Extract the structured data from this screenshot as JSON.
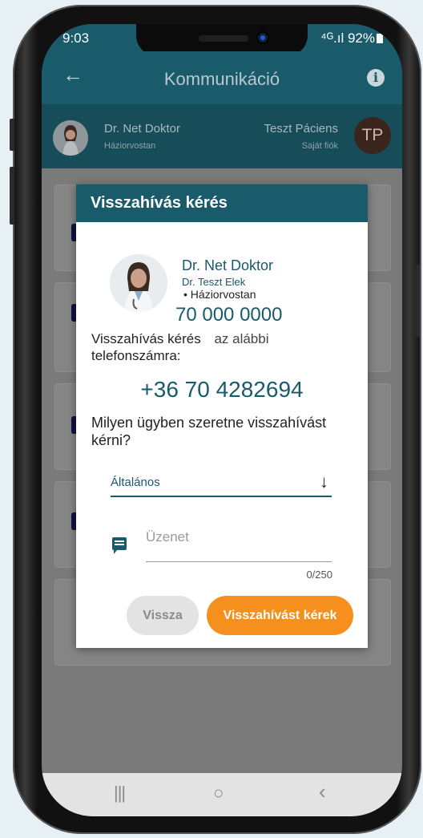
{
  "status": {
    "time": "9:03",
    "icons": "⁴ᴳ.ıl 92%",
    "battery_icon": "battery-icon"
  },
  "appbar": {
    "title": "Kommunikáció",
    "back_icon": "arrow-left-icon",
    "info_icon": "info-icon",
    "info_glyph": "i"
  },
  "userbar": {
    "doctor_name": "Dr. Net Doktor",
    "doctor_role": "Háziorvostan",
    "patient_name": "Teszt Páciens",
    "patient_role": "Saját fiók",
    "patient_initials": "TP"
  },
  "dialog": {
    "title": "Visszahívás kérés",
    "doctor_name": "Dr. Net Doktor",
    "doctor_sub": "Dr. Teszt Elek",
    "doctor_spec": "• Háziorvostan",
    "doctor_phone": "70 000 0000",
    "request_text": "Visszahívás kérés",
    "request_tail": "az alábbi",
    "request_line2": "telefonszámra:",
    "phone": "+36 70 4282694",
    "question": "Milyen ügyben szeretne visszahívást kérni?",
    "select_value": "Általános",
    "message_placeholder": "Üzenet",
    "counter": "0/250",
    "back_button": "Vissza",
    "call_button": "Visszahívást kérek"
  },
  "navbar": {
    "recent": "|||",
    "home": "○",
    "back": "‹"
  },
  "colors": {
    "primary": "#195a6b",
    "accent": "#f5901f"
  }
}
